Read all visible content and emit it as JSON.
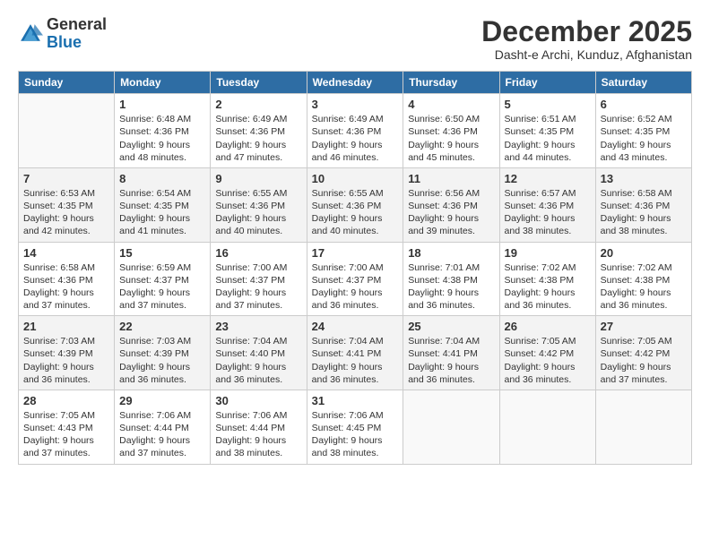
{
  "logo": {
    "general": "General",
    "blue": "Blue"
  },
  "header": {
    "month": "December 2025",
    "location": "Dasht-e Archi, Kunduz, Afghanistan"
  },
  "weekdays": [
    "Sunday",
    "Monday",
    "Tuesday",
    "Wednesday",
    "Thursday",
    "Friday",
    "Saturday"
  ],
  "weeks": [
    [
      {
        "day": "",
        "info": ""
      },
      {
        "day": "1",
        "info": "Sunrise: 6:48 AM\nSunset: 4:36 PM\nDaylight: 9 hours\nand 48 minutes."
      },
      {
        "day": "2",
        "info": "Sunrise: 6:49 AM\nSunset: 4:36 PM\nDaylight: 9 hours\nand 47 minutes."
      },
      {
        "day": "3",
        "info": "Sunrise: 6:49 AM\nSunset: 4:36 PM\nDaylight: 9 hours\nand 46 minutes."
      },
      {
        "day": "4",
        "info": "Sunrise: 6:50 AM\nSunset: 4:36 PM\nDaylight: 9 hours\nand 45 minutes."
      },
      {
        "day": "5",
        "info": "Sunrise: 6:51 AM\nSunset: 4:35 PM\nDaylight: 9 hours\nand 44 minutes."
      },
      {
        "day": "6",
        "info": "Sunrise: 6:52 AM\nSunset: 4:35 PM\nDaylight: 9 hours\nand 43 minutes."
      }
    ],
    [
      {
        "day": "7",
        "info": "Sunrise: 6:53 AM\nSunset: 4:35 PM\nDaylight: 9 hours\nand 42 minutes."
      },
      {
        "day": "8",
        "info": "Sunrise: 6:54 AM\nSunset: 4:35 PM\nDaylight: 9 hours\nand 41 minutes."
      },
      {
        "day": "9",
        "info": "Sunrise: 6:55 AM\nSunset: 4:36 PM\nDaylight: 9 hours\nand 40 minutes."
      },
      {
        "day": "10",
        "info": "Sunrise: 6:55 AM\nSunset: 4:36 PM\nDaylight: 9 hours\nand 40 minutes."
      },
      {
        "day": "11",
        "info": "Sunrise: 6:56 AM\nSunset: 4:36 PM\nDaylight: 9 hours\nand 39 minutes."
      },
      {
        "day": "12",
        "info": "Sunrise: 6:57 AM\nSunset: 4:36 PM\nDaylight: 9 hours\nand 38 minutes."
      },
      {
        "day": "13",
        "info": "Sunrise: 6:58 AM\nSunset: 4:36 PM\nDaylight: 9 hours\nand 38 minutes."
      }
    ],
    [
      {
        "day": "14",
        "info": "Sunrise: 6:58 AM\nSunset: 4:36 PM\nDaylight: 9 hours\nand 37 minutes."
      },
      {
        "day": "15",
        "info": "Sunrise: 6:59 AM\nSunset: 4:37 PM\nDaylight: 9 hours\nand 37 minutes."
      },
      {
        "day": "16",
        "info": "Sunrise: 7:00 AM\nSunset: 4:37 PM\nDaylight: 9 hours\nand 37 minutes."
      },
      {
        "day": "17",
        "info": "Sunrise: 7:00 AM\nSunset: 4:37 PM\nDaylight: 9 hours\nand 36 minutes."
      },
      {
        "day": "18",
        "info": "Sunrise: 7:01 AM\nSunset: 4:38 PM\nDaylight: 9 hours\nand 36 minutes."
      },
      {
        "day": "19",
        "info": "Sunrise: 7:02 AM\nSunset: 4:38 PM\nDaylight: 9 hours\nand 36 minutes."
      },
      {
        "day": "20",
        "info": "Sunrise: 7:02 AM\nSunset: 4:38 PM\nDaylight: 9 hours\nand 36 minutes."
      }
    ],
    [
      {
        "day": "21",
        "info": "Sunrise: 7:03 AM\nSunset: 4:39 PM\nDaylight: 9 hours\nand 36 minutes."
      },
      {
        "day": "22",
        "info": "Sunrise: 7:03 AM\nSunset: 4:39 PM\nDaylight: 9 hours\nand 36 minutes."
      },
      {
        "day": "23",
        "info": "Sunrise: 7:04 AM\nSunset: 4:40 PM\nDaylight: 9 hours\nand 36 minutes."
      },
      {
        "day": "24",
        "info": "Sunrise: 7:04 AM\nSunset: 4:41 PM\nDaylight: 9 hours\nand 36 minutes."
      },
      {
        "day": "25",
        "info": "Sunrise: 7:04 AM\nSunset: 4:41 PM\nDaylight: 9 hours\nand 36 minutes."
      },
      {
        "day": "26",
        "info": "Sunrise: 7:05 AM\nSunset: 4:42 PM\nDaylight: 9 hours\nand 36 minutes."
      },
      {
        "day": "27",
        "info": "Sunrise: 7:05 AM\nSunset: 4:42 PM\nDaylight: 9 hours\nand 37 minutes."
      }
    ],
    [
      {
        "day": "28",
        "info": "Sunrise: 7:05 AM\nSunset: 4:43 PM\nDaylight: 9 hours\nand 37 minutes."
      },
      {
        "day": "29",
        "info": "Sunrise: 7:06 AM\nSunset: 4:44 PM\nDaylight: 9 hours\nand 37 minutes."
      },
      {
        "day": "30",
        "info": "Sunrise: 7:06 AM\nSunset: 4:44 PM\nDaylight: 9 hours\nand 38 minutes."
      },
      {
        "day": "31",
        "info": "Sunrise: 7:06 AM\nSunset: 4:45 PM\nDaylight: 9 hours\nand 38 minutes."
      },
      {
        "day": "",
        "info": ""
      },
      {
        "day": "",
        "info": ""
      },
      {
        "day": "",
        "info": ""
      }
    ]
  ]
}
